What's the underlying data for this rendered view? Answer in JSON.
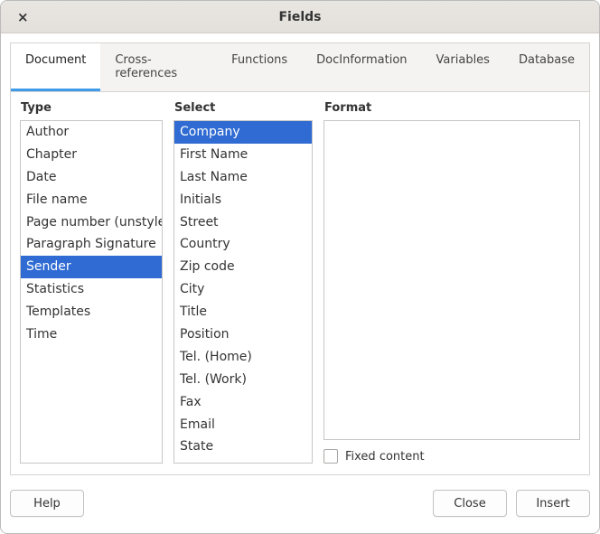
{
  "window": {
    "title": "Fields",
    "close_glyph": "×"
  },
  "tabs": [
    {
      "label": "Document",
      "active": true
    },
    {
      "label": "Cross-references",
      "active": false
    },
    {
      "label": "Functions",
      "active": false
    },
    {
      "label": "DocInformation",
      "active": false
    },
    {
      "label": "Variables",
      "active": false
    },
    {
      "label": "Database",
      "active": false
    }
  ],
  "columns": {
    "type": {
      "label": "Type",
      "items": [
        "Author",
        "Chapter",
        "Date",
        "File name",
        "Page number (unstyled)",
        "Paragraph Signature",
        "Sender",
        "Statistics",
        "Templates",
        "Time"
      ],
      "selected_index": 6
    },
    "select": {
      "label": "Select",
      "items": [
        "Company",
        "First Name",
        "Last Name",
        "Initials",
        "Street",
        "Country",
        "Zip code",
        "City",
        "Title",
        "Position",
        "Tel. (Home)",
        "Tel. (Work)",
        "Fax",
        "Email",
        "State"
      ],
      "selected_index": 0
    },
    "format": {
      "label": "Format",
      "items": []
    }
  },
  "fixed_content": {
    "label": "Fixed content",
    "checked": false
  },
  "buttons": {
    "help": "Help",
    "close": "Close",
    "insert": "Insert"
  }
}
